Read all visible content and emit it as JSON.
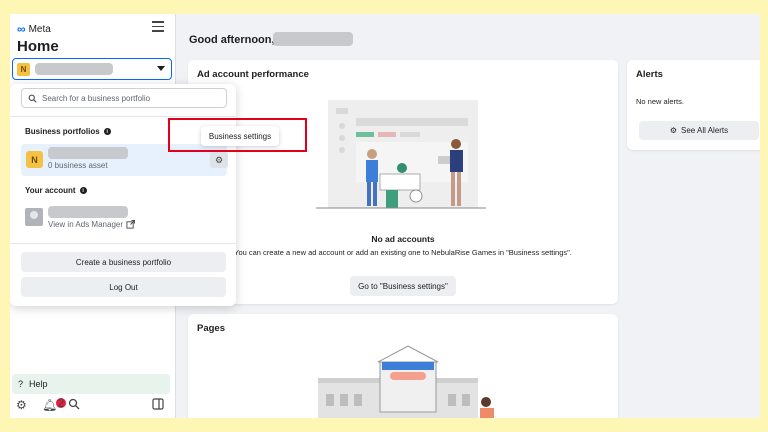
{
  "sidebar": {
    "brand": "Meta",
    "title": "Home",
    "portfolio_initial": "N",
    "help_label": "Help",
    "notification_count": "2"
  },
  "dropdown": {
    "search_placeholder": "Search for a business portfolio",
    "portfolios_heading": "Business portfolios",
    "portfolio_initial": "N",
    "portfolio_assets": "0 business asset",
    "account_heading": "Your account",
    "ads_manager_link": "View in Ads Manager",
    "create_button": "Create a business portfolio",
    "logout_button": "Log Out"
  },
  "tooltip": {
    "label": "Business settings"
  },
  "main": {
    "greeting": "Good afternoon,",
    "ad_card": {
      "title": "Ad account performance",
      "empty_title": "No ad accounts",
      "empty_desc": "You can create a new ad account or add an existing one to NebulaRise Games in \"Business settings\".",
      "button": "Go to \"Business settings\""
    },
    "alerts_card": {
      "title": "Alerts",
      "empty": "No new alerts.",
      "button": "See All Alerts"
    },
    "pages_card": {
      "title": "Pages"
    }
  },
  "colors": {
    "accent": "#0866ff",
    "highlight": "#e4001b",
    "background": "#fdf6b4"
  }
}
